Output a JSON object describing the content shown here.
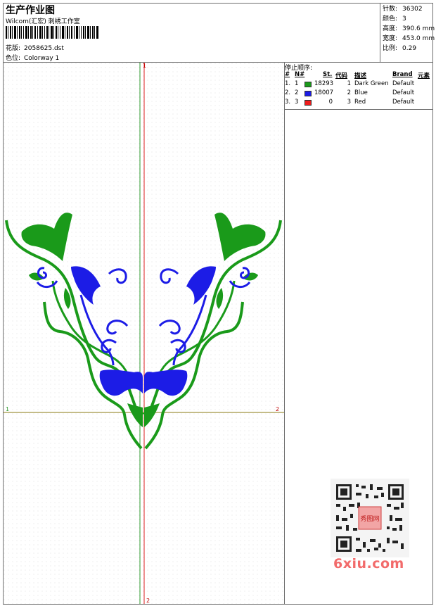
{
  "header": {
    "title": "生产作业图",
    "company": "Wilcom(汇宏) 刺绣工作室",
    "design": {
      "label": "花版:",
      "value": "2058625.dst"
    },
    "colorway": {
      "label": "色位:",
      "value": "Colorway 1"
    }
  },
  "stats": [
    {
      "label": "针数:",
      "value": "36302"
    },
    {
      "label": "颜色:",
      "value": "3"
    },
    {
      "label": "高度:",
      "value": "390.6 mm"
    },
    {
      "label": "宽度:",
      "value": "453.0 mm"
    },
    {
      "label": "比例:",
      "value": "0.29"
    }
  ],
  "stop_sequence": {
    "title": "停止顺序:",
    "headers": {
      "hash": "#",
      "no": "N#",
      "st": "St.",
      "code": "代码",
      "desc": "描述",
      "brand": "Brand",
      "elements": "元素"
    },
    "rows": [
      {
        "hash": "1.",
        "no": "1",
        "color": "#1a9a1a",
        "st": "18293",
        "code": "1",
        "desc": "Dark Green",
        "brand": "Default"
      },
      {
        "hash": "2.",
        "no": "2",
        "color": "#1c1ce6",
        "st": "18007",
        "code": "2",
        "desc": "Blue",
        "brand": "Default"
      },
      {
        "hash": "3.",
        "no": "3",
        "color": "#ee1c1c",
        "st": "0",
        "code": "3",
        "desc": "Red",
        "brand": "Default"
      }
    ]
  },
  "axis_markers": {
    "top": "1",
    "bottom": "2",
    "left": "1",
    "right": "2"
  },
  "watermark": {
    "site": "6xiu.com",
    "stamp": "秀图网"
  },
  "colors": {
    "green": "#1a9a1a",
    "blue": "#1c1ce6",
    "axis_green": "#2c9a2c",
    "axis_red": "#dd2222",
    "axis_olive": "#8a7a10"
  }
}
